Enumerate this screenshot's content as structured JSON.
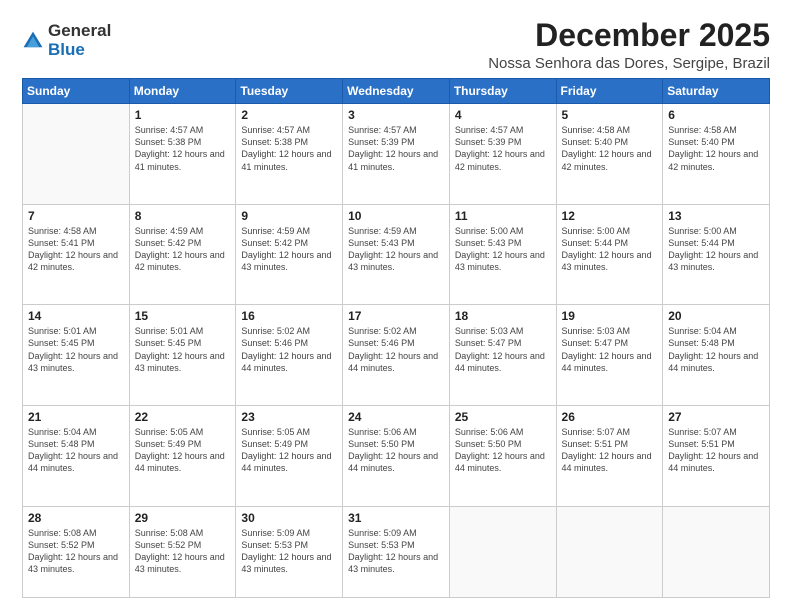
{
  "logo": {
    "general": "General",
    "blue": "Blue"
  },
  "title": "December 2025",
  "location": "Nossa Senhora das Dores, Sergipe, Brazil",
  "days": [
    "Sunday",
    "Monday",
    "Tuesday",
    "Wednesday",
    "Thursday",
    "Friday",
    "Saturday"
  ],
  "weeks": [
    [
      {
        "day": "",
        "sunrise": "",
        "sunset": "",
        "daylight": ""
      },
      {
        "day": "1",
        "sunrise": "Sunrise: 4:57 AM",
        "sunset": "Sunset: 5:38 PM",
        "daylight": "Daylight: 12 hours and 41 minutes."
      },
      {
        "day": "2",
        "sunrise": "Sunrise: 4:57 AM",
        "sunset": "Sunset: 5:38 PM",
        "daylight": "Daylight: 12 hours and 41 minutes."
      },
      {
        "day": "3",
        "sunrise": "Sunrise: 4:57 AM",
        "sunset": "Sunset: 5:39 PM",
        "daylight": "Daylight: 12 hours and 41 minutes."
      },
      {
        "day": "4",
        "sunrise": "Sunrise: 4:57 AM",
        "sunset": "Sunset: 5:39 PM",
        "daylight": "Daylight: 12 hours and 42 minutes."
      },
      {
        "day": "5",
        "sunrise": "Sunrise: 4:58 AM",
        "sunset": "Sunset: 5:40 PM",
        "daylight": "Daylight: 12 hours and 42 minutes."
      },
      {
        "day": "6",
        "sunrise": "Sunrise: 4:58 AM",
        "sunset": "Sunset: 5:40 PM",
        "daylight": "Daylight: 12 hours and 42 minutes."
      }
    ],
    [
      {
        "day": "7",
        "sunrise": "Sunrise: 4:58 AM",
        "sunset": "Sunset: 5:41 PM",
        "daylight": "Daylight: 12 hours and 42 minutes."
      },
      {
        "day": "8",
        "sunrise": "Sunrise: 4:59 AM",
        "sunset": "Sunset: 5:42 PM",
        "daylight": "Daylight: 12 hours and 42 minutes."
      },
      {
        "day": "9",
        "sunrise": "Sunrise: 4:59 AM",
        "sunset": "Sunset: 5:42 PM",
        "daylight": "Daylight: 12 hours and 43 minutes."
      },
      {
        "day": "10",
        "sunrise": "Sunrise: 4:59 AM",
        "sunset": "Sunset: 5:43 PM",
        "daylight": "Daylight: 12 hours and 43 minutes."
      },
      {
        "day": "11",
        "sunrise": "Sunrise: 5:00 AM",
        "sunset": "Sunset: 5:43 PM",
        "daylight": "Daylight: 12 hours and 43 minutes."
      },
      {
        "day": "12",
        "sunrise": "Sunrise: 5:00 AM",
        "sunset": "Sunset: 5:44 PM",
        "daylight": "Daylight: 12 hours and 43 minutes."
      },
      {
        "day": "13",
        "sunrise": "Sunrise: 5:00 AM",
        "sunset": "Sunset: 5:44 PM",
        "daylight": "Daylight: 12 hours and 43 minutes."
      }
    ],
    [
      {
        "day": "14",
        "sunrise": "Sunrise: 5:01 AM",
        "sunset": "Sunset: 5:45 PM",
        "daylight": "Daylight: 12 hours and 43 minutes."
      },
      {
        "day": "15",
        "sunrise": "Sunrise: 5:01 AM",
        "sunset": "Sunset: 5:45 PM",
        "daylight": "Daylight: 12 hours and 43 minutes."
      },
      {
        "day": "16",
        "sunrise": "Sunrise: 5:02 AM",
        "sunset": "Sunset: 5:46 PM",
        "daylight": "Daylight: 12 hours and 44 minutes."
      },
      {
        "day": "17",
        "sunrise": "Sunrise: 5:02 AM",
        "sunset": "Sunset: 5:46 PM",
        "daylight": "Daylight: 12 hours and 44 minutes."
      },
      {
        "day": "18",
        "sunrise": "Sunrise: 5:03 AM",
        "sunset": "Sunset: 5:47 PM",
        "daylight": "Daylight: 12 hours and 44 minutes."
      },
      {
        "day": "19",
        "sunrise": "Sunrise: 5:03 AM",
        "sunset": "Sunset: 5:47 PM",
        "daylight": "Daylight: 12 hours and 44 minutes."
      },
      {
        "day": "20",
        "sunrise": "Sunrise: 5:04 AM",
        "sunset": "Sunset: 5:48 PM",
        "daylight": "Daylight: 12 hours and 44 minutes."
      }
    ],
    [
      {
        "day": "21",
        "sunrise": "Sunrise: 5:04 AM",
        "sunset": "Sunset: 5:48 PM",
        "daylight": "Daylight: 12 hours and 44 minutes."
      },
      {
        "day": "22",
        "sunrise": "Sunrise: 5:05 AM",
        "sunset": "Sunset: 5:49 PM",
        "daylight": "Daylight: 12 hours and 44 minutes."
      },
      {
        "day": "23",
        "sunrise": "Sunrise: 5:05 AM",
        "sunset": "Sunset: 5:49 PM",
        "daylight": "Daylight: 12 hours and 44 minutes."
      },
      {
        "day": "24",
        "sunrise": "Sunrise: 5:06 AM",
        "sunset": "Sunset: 5:50 PM",
        "daylight": "Daylight: 12 hours and 44 minutes."
      },
      {
        "day": "25",
        "sunrise": "Sunrise: 5:06 AM",
        "sunset": "Sunset: 5:50 PM",
        "daylight": "Daylight: 12 hours and 44 minutes."
      },
      {
        "day": "26",
        "sunrise": "Sunrise: 5:07 AM",
        "sunset": "Sunset: 5:51 PM",
        "daylight": "Daylight: 12 hours and 44 minutes."
      },
      {
        "day": "27",
        "sunrise": "Sunrise: 5:07 AM",
        "sunset": "Sunset: 5:51 PM",
        "daylight": "Daylight: 12 hours and 44 minutes."
      }
    ],
    [
      {
        "day": "28",
        "sunrise": "Sunrise: 5:08 AM",
        "sunset": "Sunset: 5:52 PM",
        "daylight": "Daylight: 12 hours and 43 minutes."
      },
      {
        "day": "29",
        "sunrise": "Sunrise: 5:08 AM",
        "sunset": "Sunset: 5:52 PM",
        "daylight": "Daylight: 12 hours and 43 minutes."
      },
      {
        "day": "30",
        "sunrise": "Sunrise: 5:09 AM",
        "sunset": "Sunset: 5:53 PM",
        "daylight": "Daylight: 12 hours and 43 minutes."
      },
      {
        "day": "31",
        "sunrise": "Sunrise: 5:09 AM",
        "sunset": "Sunset: 5:53 PM",
        "daylight": "Daylight: 12 hours and 43 minutes."
      },
      {
        "day": "",
        "sunrise": "",
        "sunset": "",
        "daylight": ""
      },
      {
        "day": "",
        "sunrise": "",
        "sunset": "",
        "daylight": ""
      },
      {
        "day": "",
        "sunrise": "",
        "sunset": "",
        "daylight": ""
      }
    ]
  ]
}
